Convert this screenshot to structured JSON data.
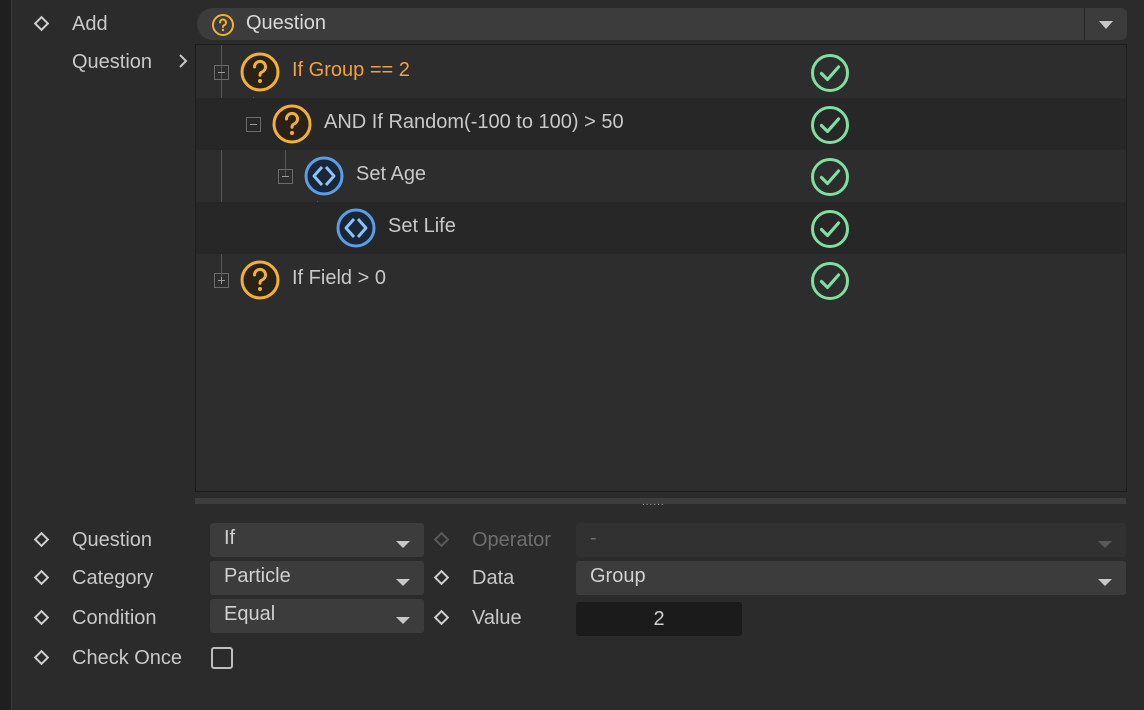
{
  "add_row": {
    "label": "Add",
    "selected": "Question"
  },
  "question_nav": {
    "label": "Question"
  },
  "tree": {
    "rows": [
      {
        "icon": "question-icon",
        "label": "If Group == 2",
        "status": "check-circle-icon",
        "expander": "minus"
      },
      {
        "icon": "question-icon",
        "label": "AND If Random(-100 to 100) > 50",
        "status": "check-circle-icon",
        "expander": "minus"
      },
      {
        "icon": "action-icon",
        "label": "Set Age",
        "status": "check-circle-icon",
        "expander": "minus"
      },
      {
        "icon": "action-icon",
        "label": "Set Life",
        "status": "check-circle-icon",
        "expander": "none"
      },
      {
        "icon": "question-icon",
        "label": "If Field > 0",
        "status": "check-circle-icon",
        "expander": "plus"
      }
    ]
  },
  "splitter": {
    "grip": "......"
  },
  "properties": {
    "question": {
      "label": "Question",
      "value": "If"
    },
    "category": {
      "label": "Category",
      "value": "Particle"
    },
    "condition": {
      "label": "Condition",
      "value": "Equal"
    },
    "check_once": {
      "label": "Check Once",
      "checked": false
    },
    "operator": {
      "label": "Operator",
      "value": "-"
    },
    "data": {
      "label": "Data",
      "value": "Group"
    },
    "value": {
      "label": "Value",
      "value": "2"
    }
  },
  "colors": {
    "question_icon": "#f2b134",
    "action_icon": "#5b9ee6",
    "check_icon": "#7ee0a0",
    "selected_text": "#f0a040"
  }
}
